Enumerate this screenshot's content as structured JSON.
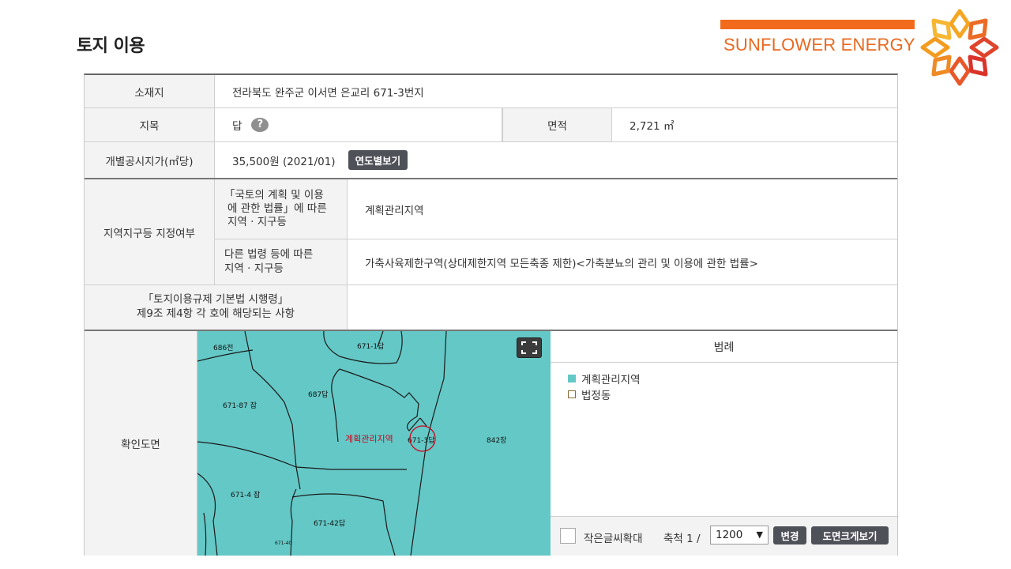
{
  "page_title": "토지 이용",
  "brand": {
    "name": "SUNFLOWER ENERGY",
    "accent": "#f26b1d"
  },
  "table": {
    "location_label": "소재지",
    "location_value": "전라북도 완주군 이서면 은교리 671-3번지",
    "land_category_label": "지목",
    "land_category_value": "답",
    "help_icon_text": "?",
    "area_label": "면적",
    "area_value": "2,721 ㎡",
    "price_label": "개별공시지가(㎡당)",
    "price_value": "35,500원 (2021/01)",
    "price_button": "연도별보기",
    "zone_label": "지역지구등 지정여부",
    "law1_label": [
      "「국토의 계획 및 이용",
      "에 관한 법률」에 따른",
      "지역 · 지구등"
    ],
    "law1_value": "계획관리지역",
    "law2_label": [
      "다른 법령 등에 따른",
      "지역 · 지구등"
    ],
    "law2_value": "가축사육제한구역(상대제한지역 모든축종 제한)<가축분뇨의 관리 및 이용에 관한 법률>",
    "decree_label": [
      "「토지이용규제 기본법 시행령」",
      "제9조 제4항 각 호에 해당되는 사항"
    ],
    "decree_value": "",
    "map_label": "확인도면"
  },
  "map": {
    "background": "#64c8c6",
    "parcels": [
      "686전",
      "671-1답",
      "687답",
      "671-87 잡",
      "671-3답",
      "842장",
      "671-4 잡",
      "671-42답",
      "671-40"
    ],
    "zone_text": "계획관리지역",
    "expand_icon": "fullscreen-icon"
  },
  "legend": {
    "title": "범례",
    "items": [
      {
        "label": "계획관리지역",
        "color": "#64c8c6"
      },
      {
        "label": "법정동",
        "color": "#ffffff"
      }
    ],
    "enlarge_label": "작은글씨확대",
    "scale_label": "축척 1 /",
    "scale_value": "1200",
    "change_button": "변경",
    "large_map_button": "도면크게보기"
  }
}
